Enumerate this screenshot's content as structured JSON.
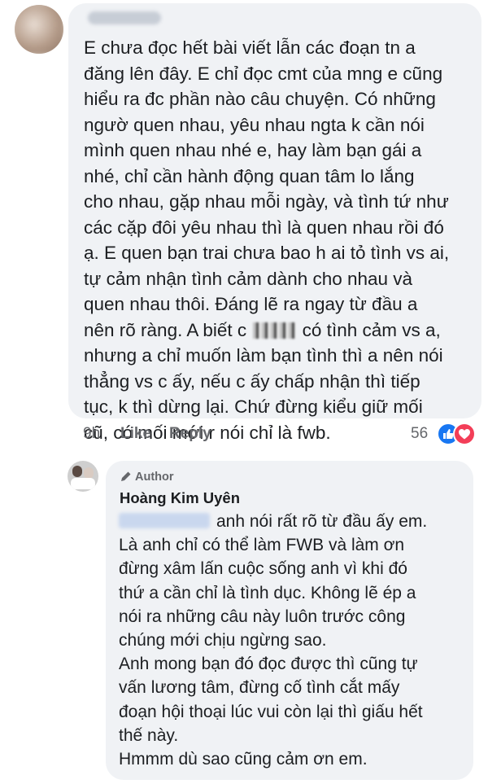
{
  "comment": {
    "lines": [
      "E chưa đọc hết bài viết lẫn các đoạn tn a",
      "đăng lên đây. E chỉ đọc cmt của mng e cũng",
      "hiểu ra đc phần nào câu chuyện. Có những",
      "ngườ quen nhau, yêu nhau ngta k cần nói",
      "mình quen nhau nhé e, hay làm bạn gái a",
      "nhé, chỉ cần hành động quan tâm lo lắng",
      "cho nhau, gặp nhau mỗi ngày, và tình tứ như",
      "các cặp đôi yêu nhau thì là quen nhau rồi đó",
      "ạ. E quen bạn trai chưa bao h ai tỏ tình vs ai,",
      "tự cảm nhận tình cảm dành cho nhau và",
      "quen nhau thôi. Đáng lẽ ra ngay từ đầu a",
      "nên rõ ràng. A biết c",
      "có tình cảm vs a,",
      "nhưng a chỉ muốn làm bạn tình thì a nên nói",
      "thẳng vs c ấy, nếu c ấy chấp nhận thì tiếp",
      "tục, k thì dừng lại. Chứ đừng kiểu giữ mối",
      "cũ, có mối mới r nói chỉ là fwb."
    ],
    "time": "9h",
    "like_label": "Like",
    "reply_label": "Reply",
    "reaction_count": "56",
    "reaction_icons": [
      "like-reaction-icon",
      "love-reaction-icon"
    ],
    "colors": {
      "like": "#1877f2",
      "love": "#f33e58",
      "bubble": "#f0f2f5",
      "meta": "#65676b"
    }
  },
  "reply": {
    "badge": "Author",
    "author_name": "Hoàng Kim Uyên",
    "lines": [
      "anh nói rất rõ từ đầu ấy em.",
      "Là anh chỉ có thể làm FWB và làm ơn",
      "đừng xâm lấn cuộc sống anh vì khi đó",
      "thứ a cần chỉ là tình dục. Không lẽ ép a",
      "nói ra những câu này luôn trước công",
      "chúng mới chịu ngừng sao.",
      "Anh mong bạn đó đọc được thì cũng tự",
      "vấn lương tâm, đừng cố tình cắt mấy",
      "đoạn hội thoại lúc vui còn lại thì giấu hết",
      "thế này.",
      "Hmmm dù sao cũng cảm ơn em."
    ]
  }
}
